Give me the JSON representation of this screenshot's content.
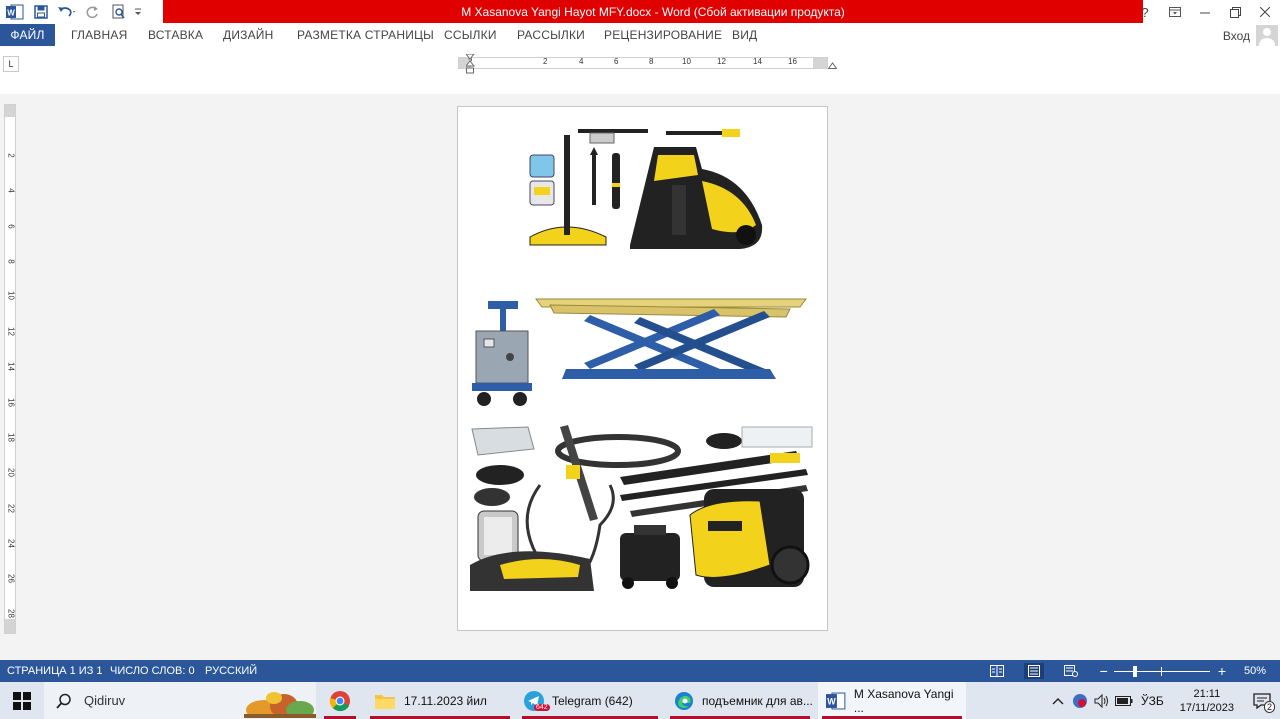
{
  "titlebar": {
    "title": "M Xasanova Yangi Hayot MFY.docx -  Word (Сбой активации продукта)",
    "window_controls": [
      "?",
      "ribbon-display-icon",
      "minimize-icon",
      "restore-icon",
      "close-icon"
    ]
  },
  "ribbon": {
    "tabs": [
      "ФАЙЛ",
      "ГЛАВНАЯ",
      "ВСТАВКА",
      "ДИЗАЙН",
      "РАЗМЕТКА СТРАНИЦЫ",
      "ССЫЛКИ",
      "РАССЫЛКИ",
      "РЕЦЕНЗИРОВАНИЕ",
      "ВИД"
    ],
    "signin_label": "Вход"
  },
  "ruler": {
    "tab_selector": "L",
    "horizontal_labels": [
      "2",
      "2",
      "4",
      "6",
      "8",
      "10",
      "12",
      "14",
      "16"
    ],
    "vertical_labels": [
      "2",
      "4",
      "6",
      "8",
      "10",
      "12",
      "14",
      "16",
      "18",
      "20",
      "22",
      "24",
      "26",
      "28"
    ]
  },
  "document": {
    "images": [
      {
        "subject": "Karcher pressure washer with accessories"
      },
      {
        "subject": "Blue scissor car lift with control unit"
      },
      {
        "subject": "Karcher pressure washer kit with hoses, guns and nozzles"
      }
    ]
  },
  "statusbar": {
    "page": "СТРАНИЦА 1 ИЗ 1",
    "words": "ЧИСЛО СЛОВ: 0",
    "language": "РУССКИЙ",
    "zoom_minus": "−",
    "zoom_plus": "+",
    "zoom": "50%",
    "zoom_level_percent": 50
  },
  "taskbar": {
    "search_placeholder": "Qidiruv",
    "apps": [
      {
        "label": "17.11.2023 йил"
      },
      {
        "label": "Telegram (642)",
        "badge": "642"
      },
      {
        "label": "подъемник для ав..."
      },
      {
        "label": "M Xasanova Yangi ..."
      }
    ],
    "tray": {
      "language": "ЎЗБ",
      "time": "21:11",
      "date": "17/11/2023",
      "notifications": "2"
    }
  },
  "colors": {
    "word_blue": "#2b579a",
    "title_red": "#e00000",
    "karcher_yellow": "#f3d21b",
    "lift_blue": "#2e5ea8"
  }
}
